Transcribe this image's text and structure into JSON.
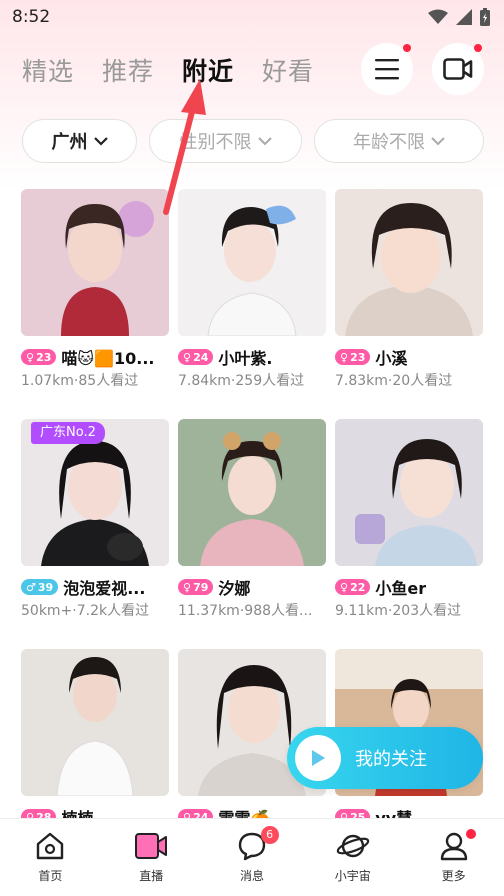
{
  "status_bar": {
    "time": "8:52"
  },
  "tabs": [
    {
      "label": "精选"
    },
    {
      "label": "推荐"
    },
    {
      "label": "附近"
    },
    {
      "label": "好看"
    }
  ],
  "active_tab": "附近",
  "header_icons": {
    "menu": "menu-icon",
    "video": "video-camera-icon"
  },
  "filters": [
    {
      "label": "广州"
    },
    {
      "label": "性别不限"
    },
    {
      "label": "年龄不限"
    }
  ],
  "cards": [
    {
      "age": "23",
      "gender": "female",
      "name": "喵🐱🟧10...",
      "distance": "1.07km",
      "viewers": "85人看过",
      "rank": ""
    },
    {
      "age": "24",
      "gender": "female",
      "name": "小叶紫.",
      "distance": "7.84km",
      "viewers": "259人看过",
      "rank": ""
    },
    {
      "age": "23",
      "gender": "female",
      "name": "小溪",
      "distance": "7.83km",
      "viewers": "20人看过",
      "rank": ""
    },
    {
      "age": "39",
      "gender": "male",
      "name": "泡泡爱视...",
      "distance": "50km+",
      "viewers": "7.2k人看过",
      "rank": "广东No.2"
    },
    {
      "age": "79",
      "gender": "female",
      "name": "汐娜",
      "distance": "11.37km",
      "viewers": "988人看...",
      "rank": ""
    },
    {
      "age": "22",
      "gender": "female",
      "name": "小鱼er",
      "distance": "9.11km",
      "viewers": "203人看过",
      "rank": ""
    },
    {
      "age": "28",
      "gender": "female",
      "name": "楠楠",
      "distance": "",
      "viewers": "",
      "rank": ""
    },
    {
      "age": "24",
      "gender": "female",
      "name": "雯雯🍊",
      "distance": "",
      "viewers": "",
      "rank": ""
    },
    {
      "age": "25",
      "gender": "female",
      "name": "yy慧",
      "distance": "",
      "viewers": "",
      "rank": ""
    }
  ],
  "separator": "·",
  "follow_button": {
    "label": "我的关注"
  },
  "bottom_nav": [
    {
      "label": "首页",
      "icon": "home-icon"
    },
    {
      "label": "直播",
      "icon": "live-camera-icon"
    },
    {
      "label": "消息",
      "icon": "message-icon",
      "badge": "6"
    },
    {
      "label": "小宇宙",
      "icon": "planet-icon"
    },
    {
      "label": "更多",
      "icon": "profile-icon"
    }
  ],
  "colors": {
    "accent_pink": "#ff5aa5",
    "male_blue": "#4cc6e8",
    "follow_cyan": "#1fb5e6",
    "badge_red": "#ff2442",
    "rank_purple": "#b24dff",
    "annotation_red": "#f0454f"
  }
}
